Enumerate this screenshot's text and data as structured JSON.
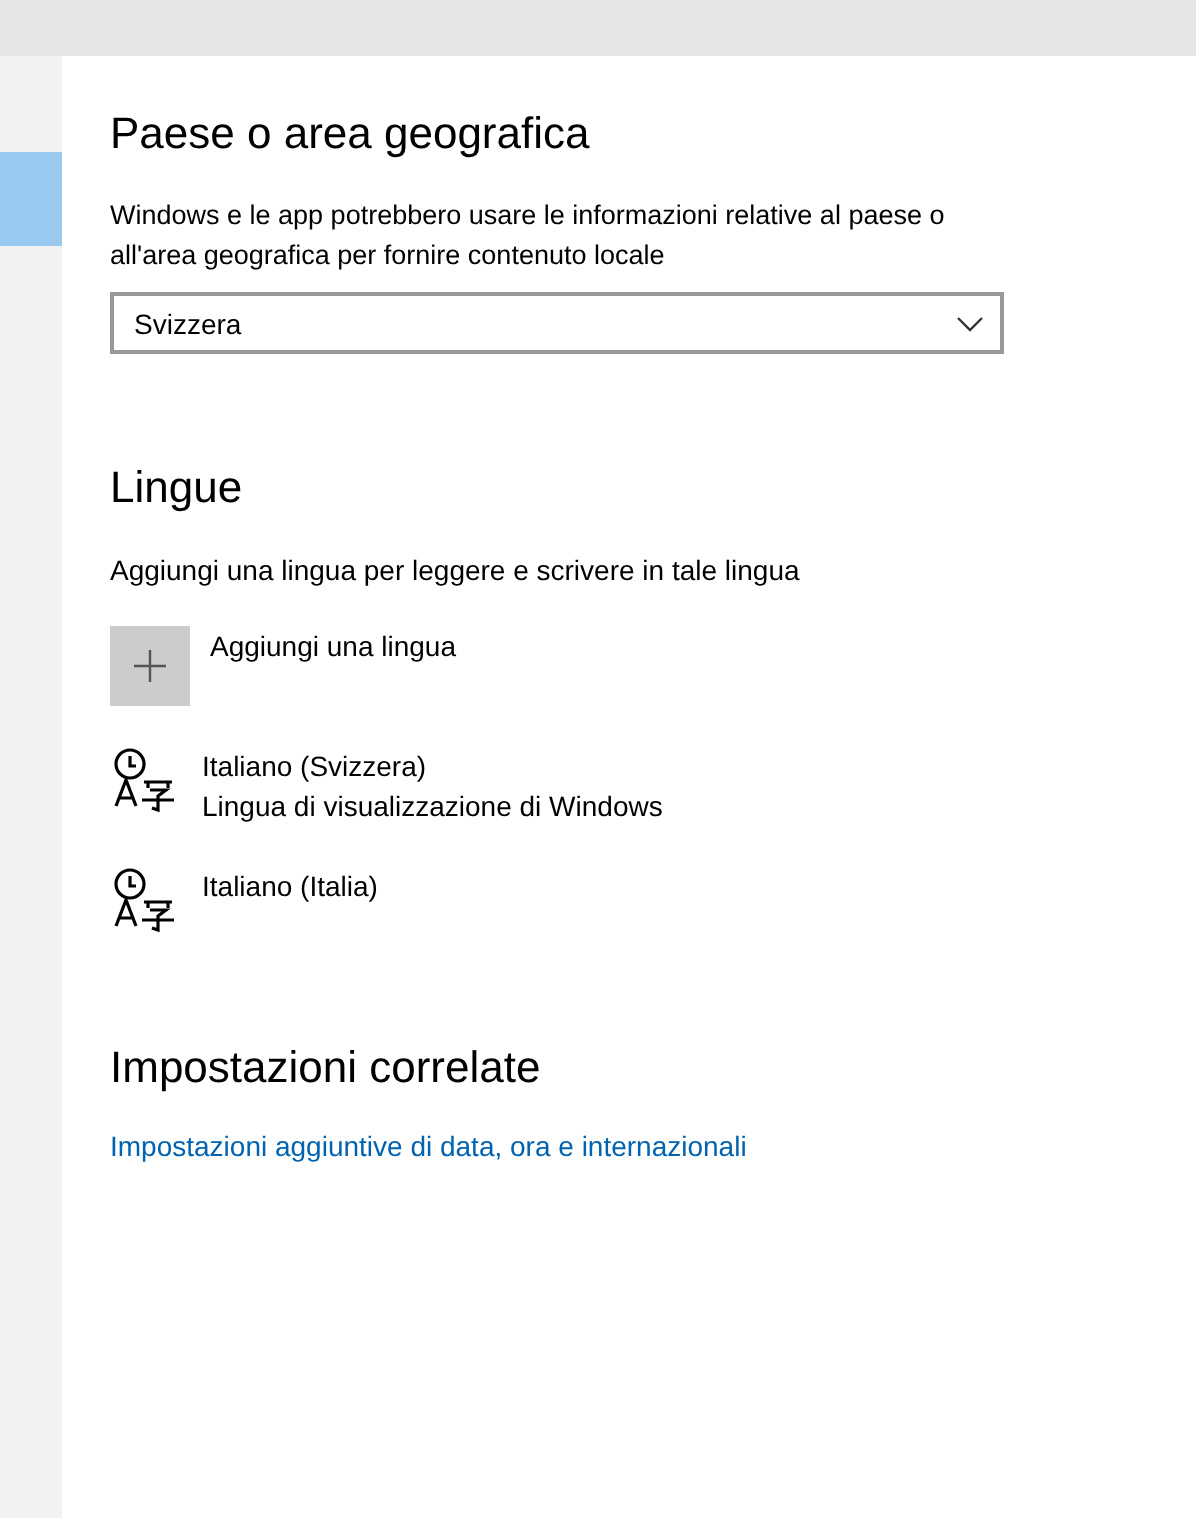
{
  "region": {
    "heading": "Paese o area geografica",
    "description": "Windows e le app potrebbero usare le informazioni relative al paese o all'area geografica per fornire contenuto locale",
    "dropdown": {
      "value": "Svizzera"
    }
  },
  "languages": {
    "heading": "Lingue",
    "description": "Aggiungi una lingua per leggere e scrivere in tale lingua",
    "add_button": "Aggiungi una lingua",
    "items": [
      {
        "name": "Italiano (Svizzera)",
        "detail": "Lingua di visualizzazione di Windows"
      },
      {
        "name": "Italiano (Italia)"
      }
    ]
  },
  "related": {
    "heading": "Impostazioni correlate",
    "link": "Impostazioni aggiuntive di data, ora e internazionali"
  }
}
